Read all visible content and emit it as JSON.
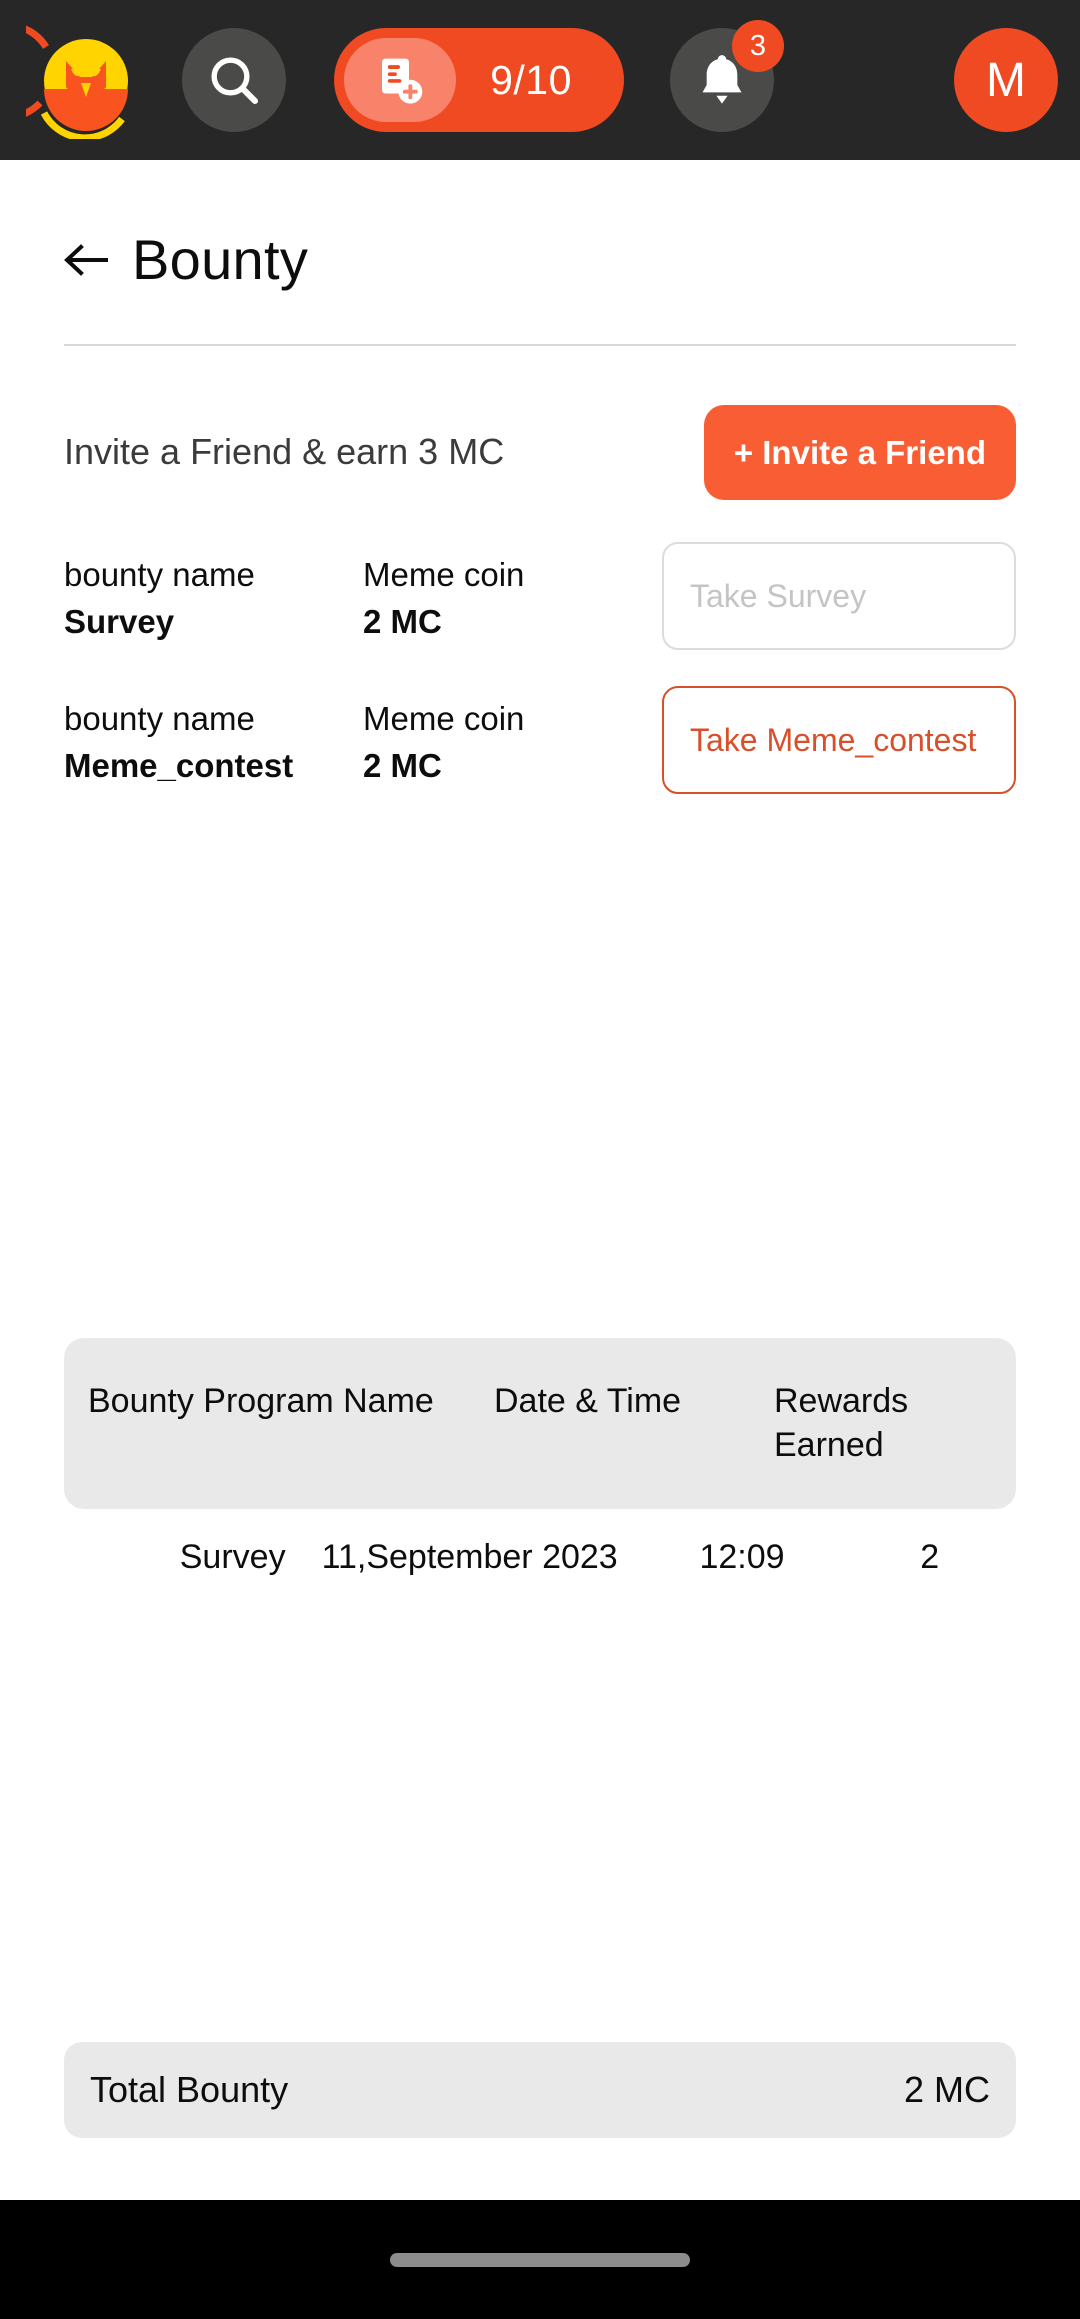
{
  "topbar": {
    "logo_icon": "owl-logo-icon",
    "search_icon": "search-icon",
    "counter": {
      "icon": "document-add-icon",
      "value": "9/10"
    },
    "notifications": {
      "icon": "bell-icon",
      "badge_count": "3"
    },
    "avatar_initial": "M"
  },
  "header": {
    "back_icon": "back-arrow-icon",
    "title": "Bounty"
  },
  "invite": {
    "text": "Invite a Friend & earn 3 MC",
    "button_label": "+ Invite a Friend"
  },
  "bounties": [
    {
      "name_label": "bounty name",
      "name_value": "Survey",
      "coin_label": "Meme coin",
      "coin_value": "2 MC",
      "action_label": "Take Survey",
      "state": "disabled"
    },
    {
      "name_label": "bounty name",
      "name_value": "Meme_contest",
      "coin_label": "Meme coin",
      "coin_value": "2 MC",
      "action_label": "Take Meme_contest",
      "state": "active"
    }
  ],
  "history": {
    "columns": {
      "name": "Bounty Program Name",
      "datetime": "Date & Time",
      "rewards": "Rewards Earned"
    },
    "rows": [
      {
        "name": "Survey",
        "date": "11,September 2023",
        "time": "12:09",
        "rewards": "2"
      }
    ]
  },
  "total": {
    "label": "Total Bounty",
    "value": "2 MC"
  },
  "colors": {
    "accent": "#F04A23",
    "accent_button": "#F95D33",
    "accent_outline": "#D8502A",
    "topbar_bg": "#272727",
    "chip_bg": "#4A4A48",
    "panel_bg": "#E9E9E9",
    "logo_yellow": "#FFD400"
  }
}
